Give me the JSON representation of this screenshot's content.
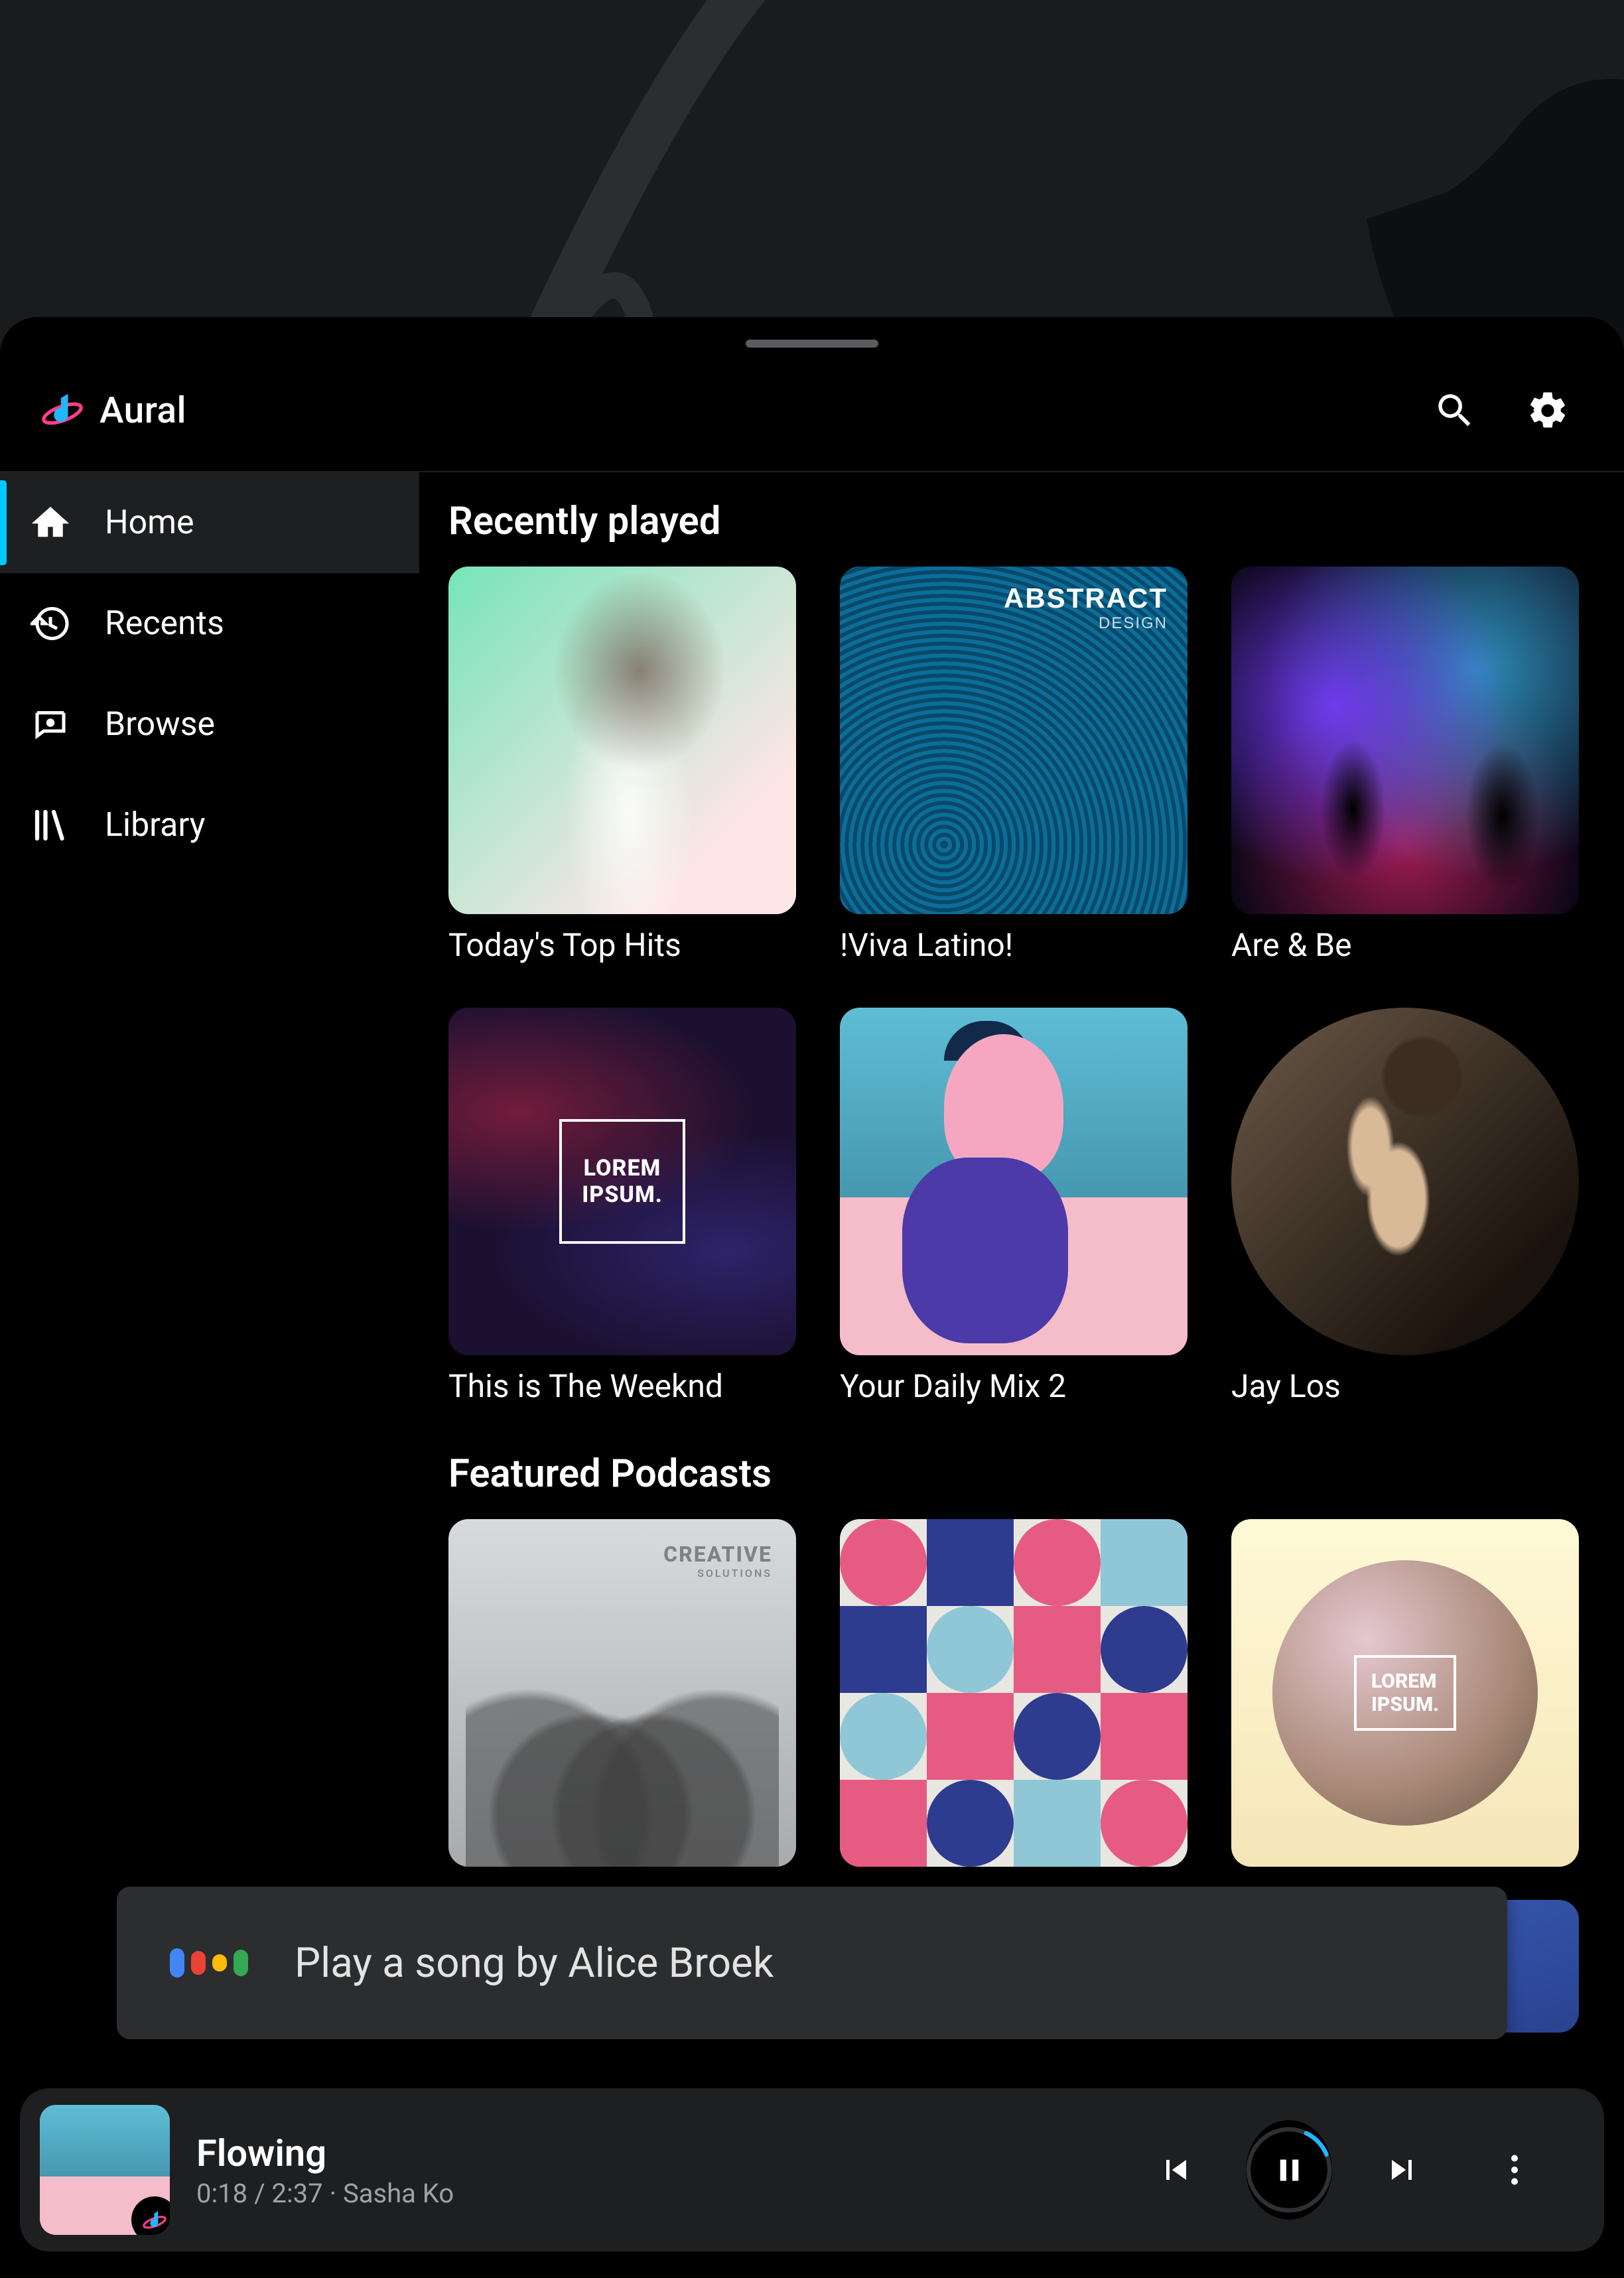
{
  "app": {
    "title": "Aural"
  },
  "nav": {
    "items": [
      {
        "label": "Home",
        "icon": "home-icon",
        "active": true
      },
      {
        "label": "Recents",
        "icon": "history-icon",
        "active": false
      },
      {
        "label": "Browse",
        "icon": "browse-icon",
        "active": false
      },
      {
        "label": "Library",
        "icon": "library-icon",
        "active": false
      }
    ]
  },
  "sections": {
    "recently_played": {
      "title": "Recently played",
      "items": [
        {
          "label": "Today's Top Hits",
          "shape": "rounded",
          "art": "cov-tth"
        },
        {
          "label": "!Viva Latino!",
          "shape": "rounded",
          "art": "cov-abstract",
          "overlay": {
            "line1": "ABSTRACT",
            "line2": "DESIGN"
          }
        },
        {
          "label": "Are & Be",
          "shape": "rounded",
          "art": "cov-concert"
        },
        {
          "label": "This is The Weeknd",
          "shape": "rounded",
          "art": "cov-lorem",
          "overlay": {
            "line1": "LOREM",
            "line2": "IPSUM."
          }
        },
        {
          "label": "Your Daily Mix 2",
          "shape": "rounded",
          "art": "cov-mix"
        },
        {
          "label": "Jay Los",
          "shape": "circle",
          "art": "cov-jaylos"
        }
      ]
    },
    "featured_podcasts": {
      "title": "Featured Podcasts",
      "row1": [
        {
          "art": "cov-creative",
          "overlay": {
            "line1": "CREATIVE",
            "line2": "SOLUTIONS"
          }
        },
        {
          "art": "cov-geo"
        },
        {
          "art": "cov-sphere",
          "overlay": {
            "line1": "LOREM",
            "line2": "IPSUM."
          }
        }
      ],
      "row2": [
        {
          "art": "cov-maroon"
        },
        {
          "art": "cov-grey"
        },
        {
          "art": "cov-blue"
        }
      ]
    }
  },
  "assistant": {
    "text": "Play a song by Alice Broek"
  },
  "now_playing": {
    "title": "Flowing",
    "elapsed": "0:18",
    "duration": "2:37",
    "artist": "Sasha Ko",
    "separator": " / ",
    "dot": " · ",
    "progress_pct": 12,
    "state": "playing"
  },
  "colors": {
    "accent": "#00c8ff",
    "background": "#000000",
    "panel": "#1e1f21",
    "assistant_blue": "#4285f4",
    "assistant_red": "#ea4335",
    "assistant_yellow": "#fbbc05",
    "assistant_green": "#34a853"
  }
}
